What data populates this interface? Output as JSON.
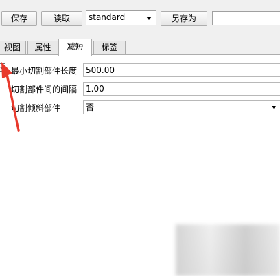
{
  "toolbar": {
    "save_label": "保存",
    "load_label": "读取",
    "preset_value": "standard",
    "save_as_label": "另存为",
    "name_value": ""
  },
  "tabs": [
    {
      "label": "视图"
    },
    {
      "label": "属性"
    },
    {
      "label": "减短"
    },
    {
      "label": "标签"
    }
  ],
  "fields": {
    "min_length": {
      "checked": true,
      "label": "最小切割部件长度",
      "value": "500.00"
    },
    "spacing": {
      "label": "切割部件间的间隔",
      "value": "1.00"
    },
    "tilt": {
      "label": "切割倾斜部件",
      "value": "否"
    }
  },
  "colors": {
    "annotation_arrow": "#e8392c"
  },
  "icons": {
    "checkmark": "check-icon",
    "dropdown": "chevron-down-icon",
    "annotation": "arrow-icon"
  }
}
